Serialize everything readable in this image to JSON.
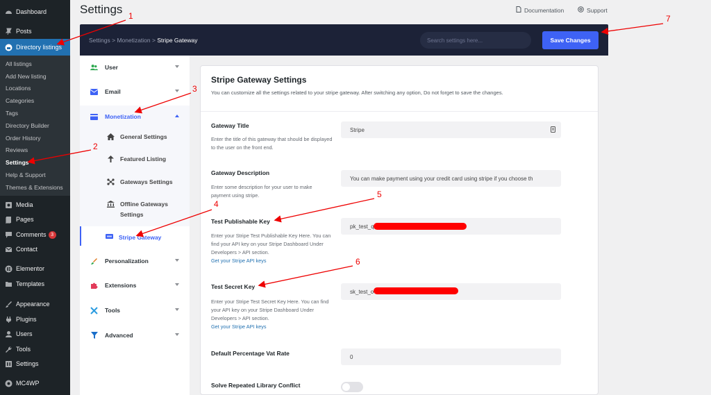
{
  "wp_menu": {
    "dashboard": "Dashboard",
    "posts": "Posts",
    "directory_listings": "Directory listings",
    "submenu": [
      "All listings",
      "Add New listing",
      "Locations",
      "Categories",
      "Tags",
      "Directory Builder",
      "Order History",
      "Reviews",
      "Settings",
      "Help & Support",
      "Themes & Extensions"
    ],
    "media": "Media",
    "pages": "Pages",
    "comments": "Comments",
    "comments_count": "3",
    "contact": "Contact",
    "elementor": "Elementor",
    "templates": "Templates",
    "appearance": "Appearance",
    "plugins": "Plugins",
    "users": "Users",
    "tools": "Tools",
    "settings": "Settings",
    "mc4wp": "MC4WP"
  },
  "header": {
    "title": "Settings",
    "documentation": "Documentation",
    "support": "Support"
  },
  "toolbar": {
    "breadcrumb_1": "Settings",
    "breadcrumb_2": "Monetization",
    "breadcrumb_3": "Stripe Gateway",
    "sep": ">",
    "search_placeholder": "Search settings here...",
    "save_label": "Save Changes"
  },
  "settings_nav": {
    "user": "User",
    "email": "Email",
    "monetization": "Monetization",
    "general": "General Settings",
    "featured": "Featured Listing",
    "gateways": "Gateways Settings",
    "offline_1": "Offline Gateways",
    "offline_2": "Settings",
    "stripe": "Stripe Gateway",
    "personalization": "Personalization",
    "extensions": "Extensions",
    "tools": "Tools",
    "advanced": "Advanced"
  },
  "panel": {
    "title": "Stripe Gateway Settings",
    "description": "You can customize all the settings related to your stripe gateway. After switching any option, Do not forget to save the changes.",
    "gateway_title_label": "Gateway Title",
    "gateway_title_desc": "Enter the title of this gateway that should be displayed to the user on the front end.",
    "gateway_title_value": "Stripe",
    "gateway_desc_label": "Gateway Description",
    "gateway_desc_desc": "Enter some description for your user to make payment using stripe.",
    "gateway_desc_value": "You can make payment using your credit card using stripe if you choose th",
    "pub_key_label": "Test Publishable Key",
    "pub_key_desc": "Enter your Stripe Test Publishable Key Here. You can find your API key on your Stripe Dashboard Under Developers > API section.",
    "pub_key_link": "Get your Stripe API keys",
    "pub_key_value": "pk_test_q",
    "secret_key_label": "Test Secret Key",
    "secret_key_desc": "Enter your Stripe Test Secret Key Here. You can find your API key on your Stripe Dashboard Under Developers > API section.",
    "secret_key_link": "Get your Stripe API keys",
    "secret_key_value": "sk_test_o",
    "vat_label": "Default Percentage Vat Rate",
    "vat_value": "0",
    "conflict_label": "Solve Repeated Library Conflict"
  },
  "annotations": [
    "1",
    "2",
    "3",
    "4",
    "5",
    "6",
    "7"
  ],
  "colors": {
    "accent": "#3e62f5",
    "wp_active": "#2271b1",
    "annotation": "#ee0000",
    "dark_bar": "#1c2237"
  }
}
